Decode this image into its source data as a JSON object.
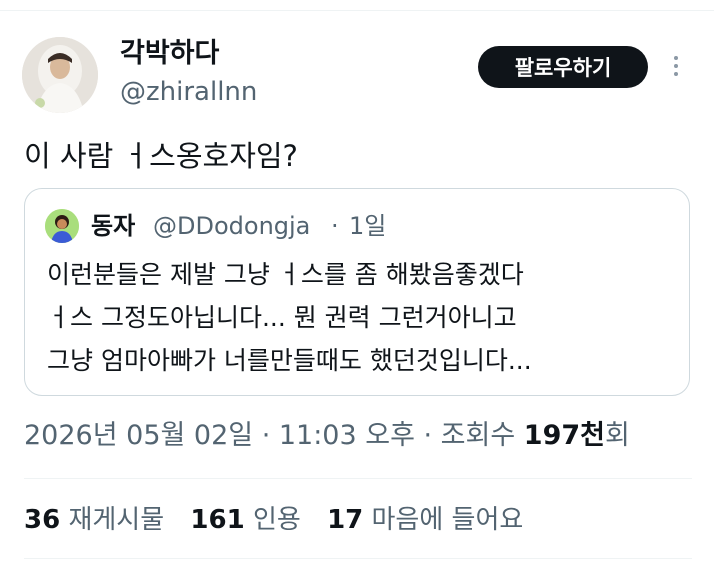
{
  "author": {
    "display_name": "각박하다",
    "handle": "@zhirallnn"
  },
  "follow_label": "팔로우하기",
  "tweet_text": "이 사람 ㅓ스옹호자임?",
  "quoted": {
    "name": "동자",
    "handle": "@DDodongja",
    "separator": "·",
    "time": "1일",
    "lines": [
      "이런분들은 제발 그냥 ㅓ스를 좀 해봤음좋겠다",
      "ㅓ스 그정도아닙니다... 뭔 권력 그런거아니고",
      "그냥 엄마아빠가 너를만들때도 했던것입니다..."
    ]
  },
  "meta": {
    "datetime": "2026년 05월 02일 · 11:03 오후 · 조회수 ",
    "views_num": "197천",
    "views_suffix": "회"
  },
  "stats": {
    "reposts_num": "36",
    "reposts_label": "재게시물",
    "quotes_num": "161",
    "quotes_label": "인용",
    "likes_num": "17",
    "likes_label": "마음에 들어요"
  },
  "colors": {
    "text": "#0f1419",
    "secondary": "#536471",
    "button_bg": "#0f1419",
    "border": "#cfd9de"
  },
  "icons": {
    "more": "more-vertical-icon"
  }
}
